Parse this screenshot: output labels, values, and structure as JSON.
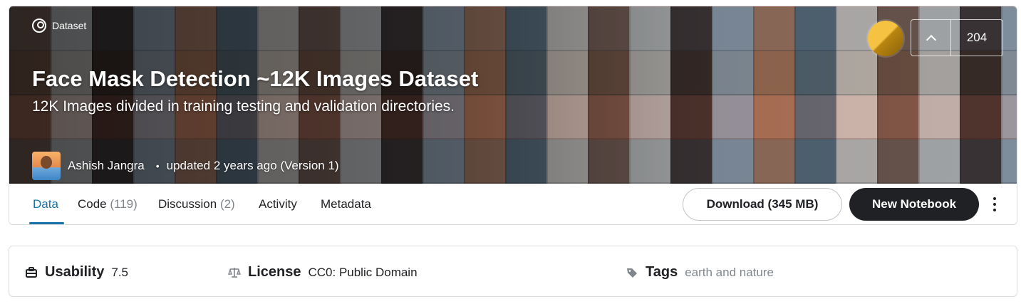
{
  "header": {
    "type_label": "Dataset",
    "title": "Face Mask Detection ~12K Images Dataset",
    "subtitle": "12K Images divided in training testing and validation directories.",
    "author": "Ashish Jangra",
    "updated": "updated 2 years ago (Version 1)",
    "medal": "gold",
    "upvotes": "204"
  },
  "tabs": [
    {
      "label": "Data",
      "count": "",
      "active": true
    },
    {
      "label": "Code",
      "count": "(119)"
    },
    {
      "label": "Discussion",
      "count": "(2)"
    },
    {
      "label": "Activity",
      "count": ""
    },
    {
      "label": "Metadata",
      "count": ""
    }
  ],
  "actions": {
    "download_label": "Download (345 MB)",
    "new_notebook_label": "New Notebook"
  },
  "meta": {
    "usability_label": "Usability",
    "usability_value": "7.5",
    "license_label": "License",
    "license_value": "CC0: Public Domain",
    "tags_label": "Tags",
    "tags_value": "earth and nature"
  },
  "colors": {
    "accent": "#1a73a8",
    "primary_button": "#202124",
    "medal_gold": "#f5c242"
  }
}
